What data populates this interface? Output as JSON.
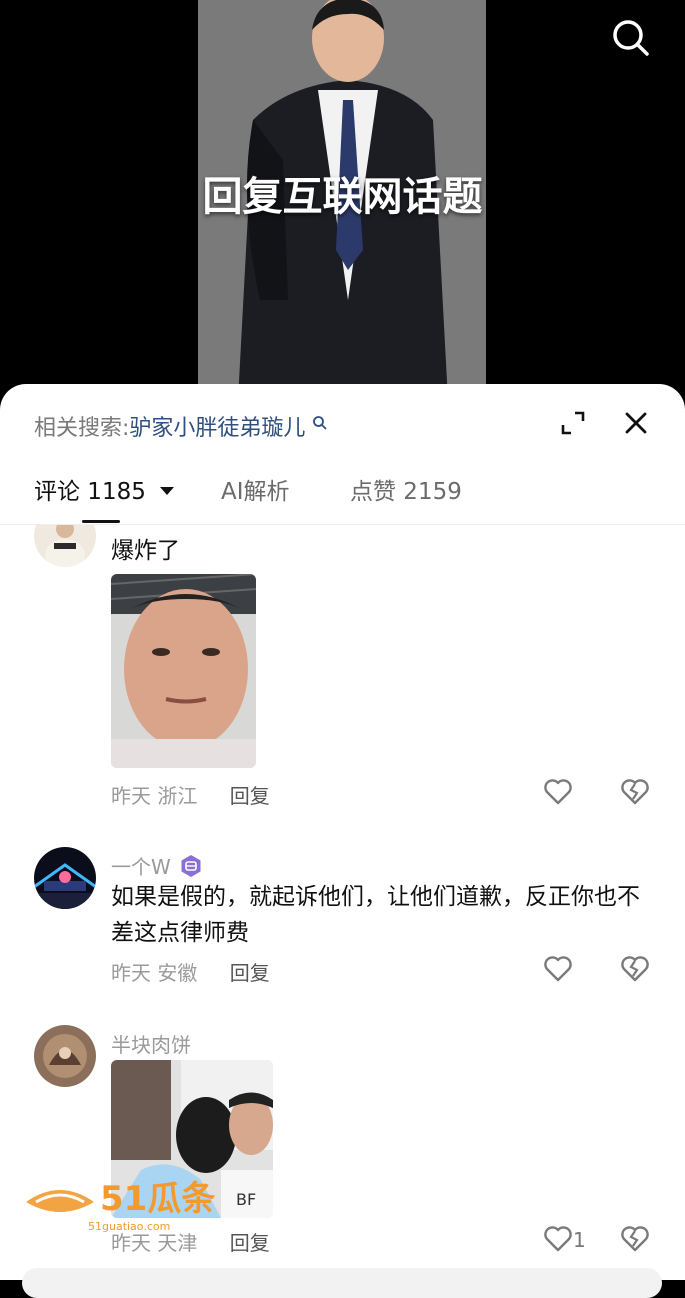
{
  "video": {
    "overlay_title": "回复互联网话题"
  },
  "sheet": {
    "related_label": "相关搜索:",
    "related_query": "驴家小胖徒弟璇儿",
    "tabs": [
      {
        "label": "评论 1185"
      },
      {
        "label": "AI解析"
      },
      {
        "label": "点赞 2159"
      }
    ]
  },
  "comments": [
    {
      "text": "爆炸了",
      "date": "昨天",
      "location": "浙江",
      "reply": "回复"
    },
    {
      "username": "一个W",
      "text": "如果是假的，就起诉他们，让他们道歉，反正你也不差这点律师费",
      "date": "昨天",
      "location": "安徽",
      "reply": "回复"
    },
    {
      "username": "半块肉饼",
      "date": "昨天",
      "location": "天津",
      "reply": "回复",
      "likes": "1"
    }
  ],
  "watermark": {
    "brand": "51瓜条",
    "url": "51guatiao.com"
  },
  "colors": {
    "related_query": "#2f4f7f",
    "badge": "#8a6fd6",
    "watermark": "#f29a2e"
  }
}
